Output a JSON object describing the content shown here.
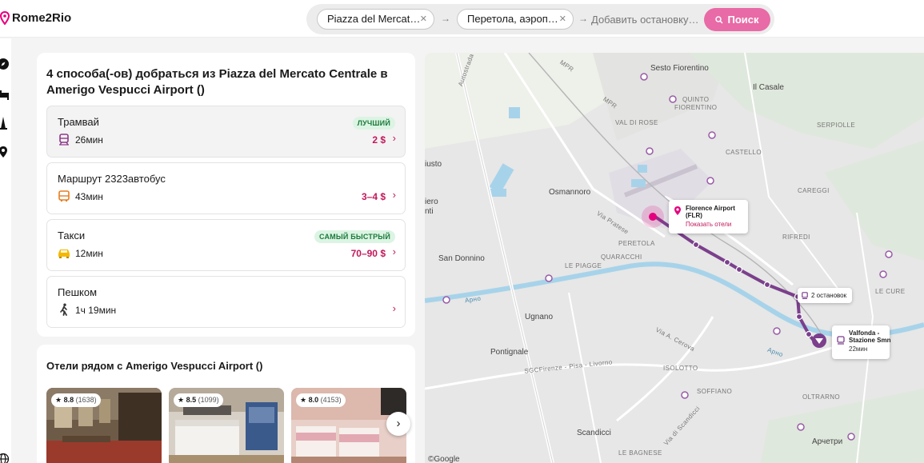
{
  "app": {
    "logo_text": "Rome2Rio",
    "brand_color": "#e6007e"
  },
  "search": {
    "origin": "Piazza del Mercat…",
    "destination": "Перетола, аэроп…",
    "add_stop_placeholder": "Добавить остановку…",
    "search_button": "Поиск",
    "clear_icon": "close-icon",
    "arrow_glyph": "→"
  },
  "rail": {
    "icons": [
      "compass-icon",
      "bed-icon",
      "landmark-icon",
      "pin-icon",
      "globe-icon"
    ]
  },
  "results": {
    "title": "4 способа(-ов) добраться из Piazza del Mercato Centrale в Amerigo Vespucci Airport ()",
    "routes": [
      {
        "name": "Трамвай",
        "duration": "26мин",
        "price": "2 $",
        "badge": "ЛУЧШИЙ",
        "icon": "tram-icon",
        "color": "#8e3a8c"
      },
      {
        "name": "Маршрут 2323автобус",
        "duration": "43мин",
        "price": "3–4 $",
        "badge": "",
        "icon": "bus-icon",
        "color": "#e67e22"
      },
      {
        "name": "Такси",
        "duration": "12мин",
        "price": "70–90 $",
        "badge": "САМЫЙ БЫСТРЫЙ",
        "icon": "taxi-icon",
        "color": "#f5b800"
      },
      {
        "name": "Пешком",
        "duration": "1ч 19мин",
        "price": "",
        "badge": "",
        "icon": "walk-icon",
        "color": "#333333"
      }
    ]
  },
  "hotels": {
    "title": "Отели рядом с Amerigo Vespucci Airport ()",
    "items": [
      {
        "rating": "8.8",
        "reviews": "(1638)"
      },
      {
        "rating": "8.5",
        "reviews": "(1099)"
      },
      {
        "rating": "8.0",
        "reviews": "(4153)"
      }
    ],
    "next_icon": "chevron-right-icon"
  },
  "map": {
    "labels": {
      "sesto": "Sesto\nFiorentino",
      "il_casale": "Il Casale",
      "quinto": "QUINTO\nFIORENTINO",
      "val_di_rose": "VAL DI ROSE",
      "sepiolle": "SERPIOLLE",
      "castello": "CASTELLO",
      "osmannoro": "Osmannoro",
      "careggi": "CAREGGI",
      "rifredi": "RIFREDI",
      "peretola": "PERETOLA",
      "quaracchi": "QUARACCHI",
      "le_piagge": "LE PIAGGE",
      "san_donnino": "San Donnino",
      "ugnano": "Ugnano",
      "le_cure": "LE CURE",
      "pontignale": "Pontignale",
      "isolotto": "ISOLOTTO",
      "soffiano": "SOFFIANO",
      "oltrarno": "OLTRARNO",
      "scandicci": "Scandicci",
      "arcetri": "Арчетри",
      "le_bagnese": "LE BAGNESE",
      "isto": "iusto",
      "ero": "iero\nnti",
      "arno1": "Арно",
      "arno2": "Арно",
      "via_pratese": "Via Pratese",
      "mpr1": "MPR",
      "mpr2": "MPR",
      "autostrada": "Autostrada del Sole",
      "sgc": "SGCFirenze - Pisa - Livorno",
      "via_cerova": "Via A. Cerova",
      "via_scandicci": "Via di Scandicci",
      "google": "©Google"
    },
    "airport_callout": {
      "title": "Florence Airport\n(FLR)",
      "link": "Показать отели"
    },
    "stops_callout": "2 остановок",
    "station_callout": {
      "title": "Valfonda -\nStazione Smn",
      "time": "22мин"
    },
    "route_color": "#7b3f8c"
  }
}
